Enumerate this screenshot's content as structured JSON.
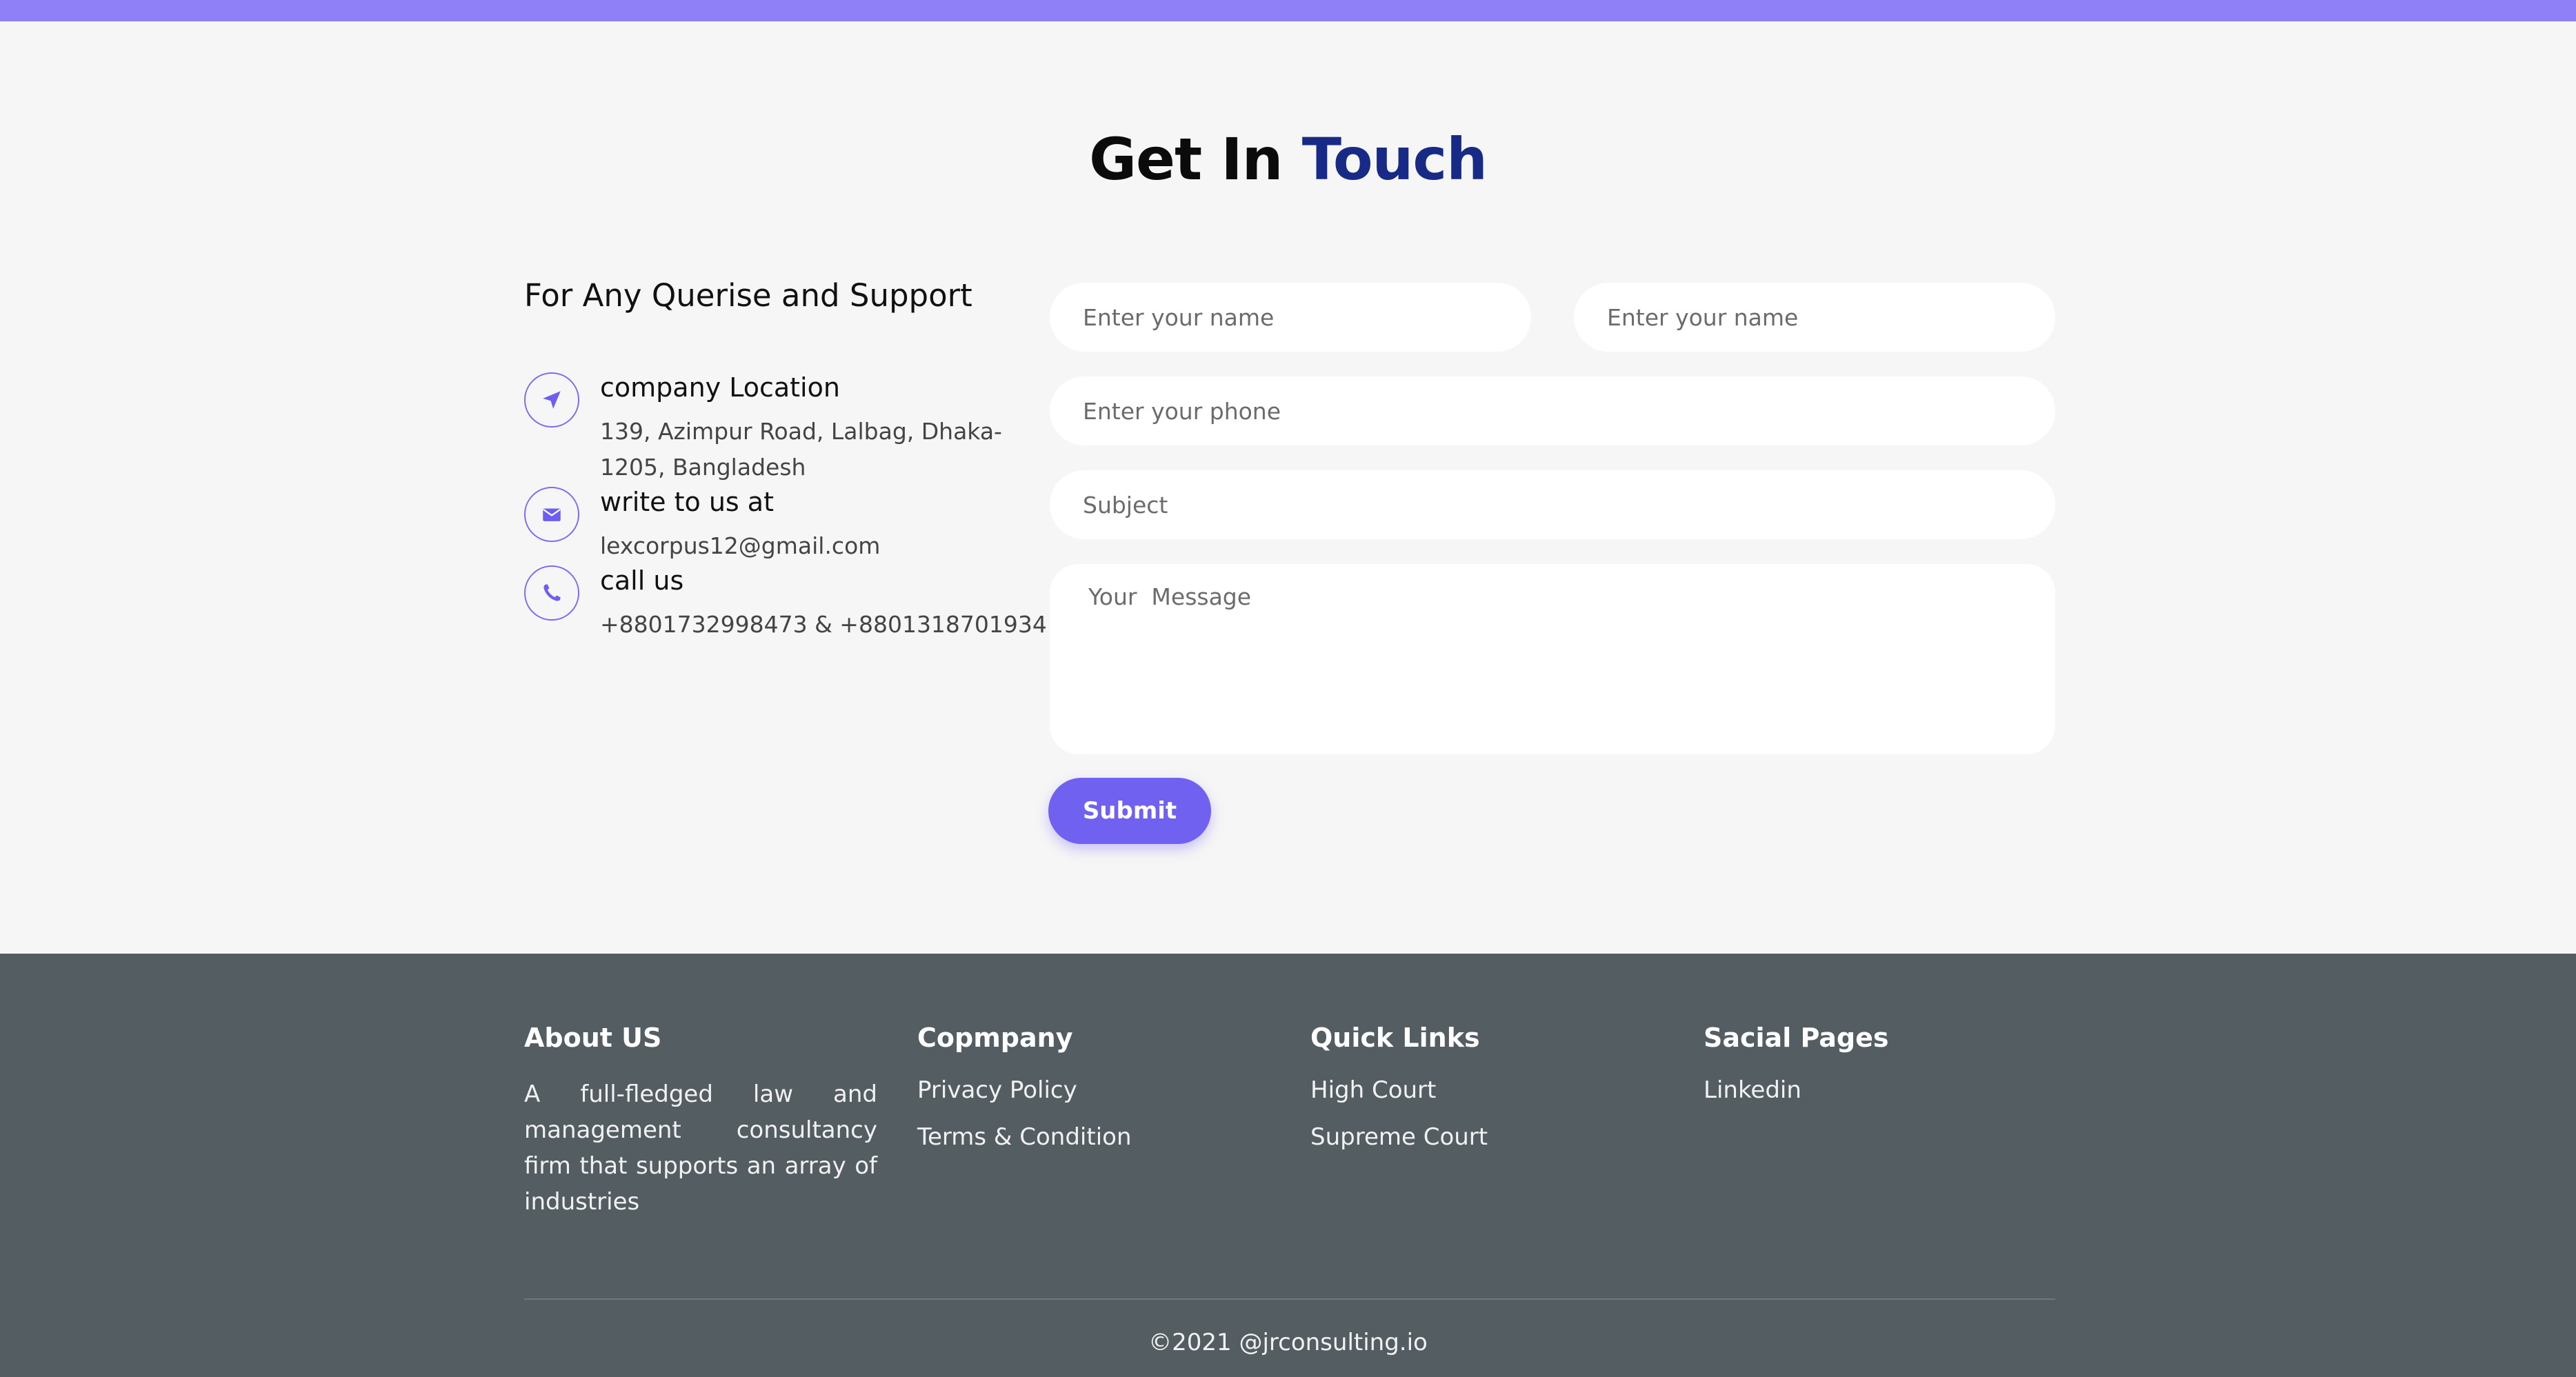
{
  "contact": {
    "title_part1": "Get In",
    "title_part2": "Touch",
    "support_heading": "For Any Querise and Support",
    "location": {
      "title": "company Location",
      "line1": "139, Azimpur Road, Lalbag, Dhaka-",
      "line2": "1205, Bangladesh",
      "icon": "location-arrow-icon"
    },
    "email": {
      "title": "write to us at",
      "value": "lexcorpus12@gmail.com",
      "icon": "envelope-icon"
    },
    "phone": {
      "title": "call us",
      "value": "+8801732998473 & +8801318701934",
      "icon": "phone-icon"
    },
    "accent_color": "#7161f0",
    "title_accent_color": "#172a85"
  },
  "form": {
    "name_placeholder": "Enter your name",
    "name2_placeholder": "Enter your name",
    "phone_placeholder": "Enter your phone",
    "subject_placeholder": "Subject",
    "message_placeholder": "Your  Message",
    "submit_label": "Submit"
  },
  "footer": {
    "about": {
      "heading": "About US",
      "text": "A full-fledged law and management consultancy firm that supports an array of industries"
    },
    "company": {
      "heading": "Copmpany",
      "links": [
        "Privacy Policy",
        "Terms & Condition"
      ]
    },
    "quick_links": {
      "heading": "Quick Links",
      "links": [
        "High Court",
        "Supreme Court"
      ]
    },
    "social": {
      "heading": "Sacial Pages",
      "links": [
        "Linkedin"
      ]
    },
    "copyright": "©2021 @jrconsulting.io",
    "background_color": "#545d62"
  }
}
